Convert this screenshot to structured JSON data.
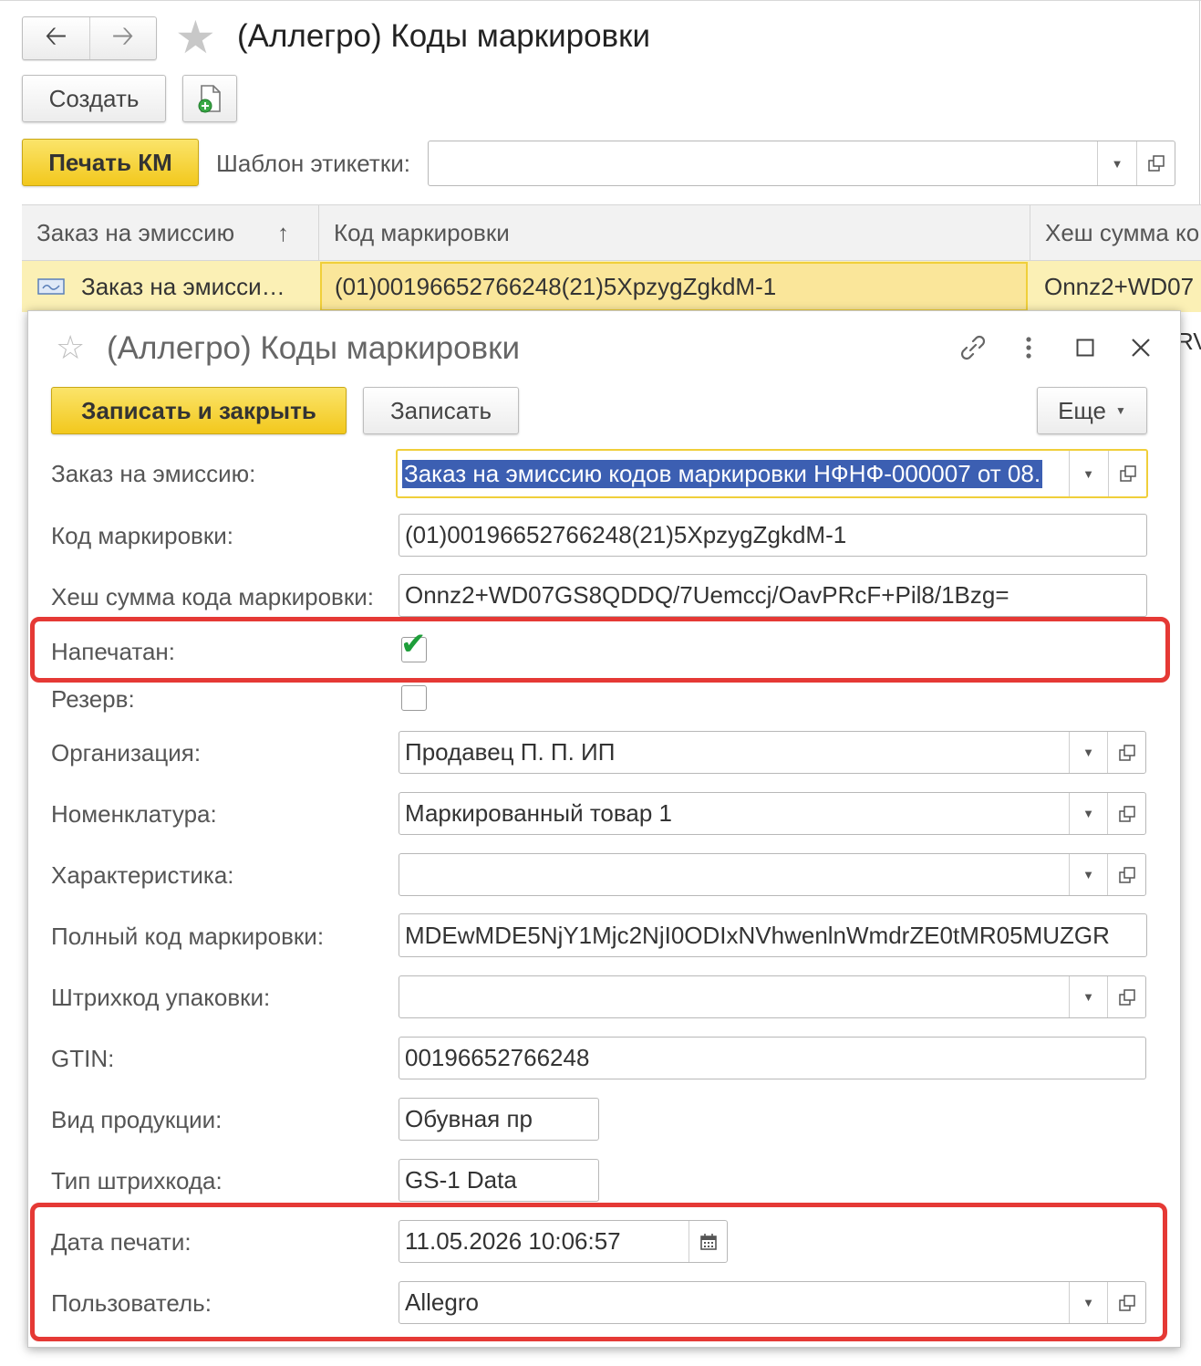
{
  "list_window": {
    "title": "(Аллегро) Коды маркировки",
    "back_icon": "arrow-left-icon",
    "forward_icon": "arrow-right-icon",
    "create_label": "Создать",
    "print_label": "Печать КМ",
    "template_label": "Шаблон этикетки:",
    "template_value": "",
    "columns": [
      "Заказ на эмиссию",
      "Код маркировки",
      "Хеш сумма ко"
    ],
    "sort_indicator": "↑",
    "rows": [
      {
        "order": "Заказ на эмисси…",
        "code": "(01)00196652766248(21)5XpzygZgkdM-1",
        "hash": "Onnz2+WD07"
      }
    ],
    "row2_fragment": "RV"
  },
  "form": {
    "title": "(Аллегро) Коды маркировки",
    "buttons": {
      "save_close": "Записать и закрыть",
      "save": "Записать",
      "more": "Еще"
    },
    "fields": {
      "order_label": "Заказ на эмиссию:",
      "order_value": "Заказ на эмиссию кодов маркировки НФНФ-000007 от 08.",
      "code_label": "Код маркировки:",
      "code_value": "(01)00196652766248(21)5XpzygZgkdM-1",
      "hash_label": "Хеш сумма кода маркировки:",
      "hash_value": "Onnz2+WD07GS8QDDQ/7Uemccj/OavPRcF+Pil8/1Bzg=",
      "printed_label": "Напечатан:",
      "printed_checked": true,
      "reserve_label": "Резерв:",
      "reserve_checked": false,
      "org_label": "Организация:",
      "org_value": "Продавец П. П. ИП",
      "nomen_label": "Номенклатура:",
      "nomen_value": "Маркированный товар 1",
      "char_label": "Характеристика:",
      "char_value": "",
      "full_code_label": "Полный код маркировки:",
      "full_code_value": "MDEwMDE5NjY1Mjc2NjI0ODIxNVhwenlnWmdrZE0tMR05MUZGR",
      "pack_label": "Штрихкод упаковки:",
      "pack_value": "",
      "gtin_label": "GTIN:",
      "gtin_value": "00196652766248",
      "product_label": "Вид продукции:",
      "product_value": "Обувная пр",
      "barcode_type_label": "Тип штрихкода:",
      "barcode_type_value": "GS-1 Data",
      "print_date_label": "Дата печати:",
      "print_date_value": "11.05.2026 10:06:57",
      "user_label": "Пользователь:",
      "user_value": "Allegro"
    }
  },
  "colors": {
    "accent_yellow": "#f2c81d",
    "selected_row": "#fbf0b5",
    "highlight_red": "#e53935",
    "check_green": "#1e9e3a",
    "selection_blue": "#3c5fb2"
  }
}
